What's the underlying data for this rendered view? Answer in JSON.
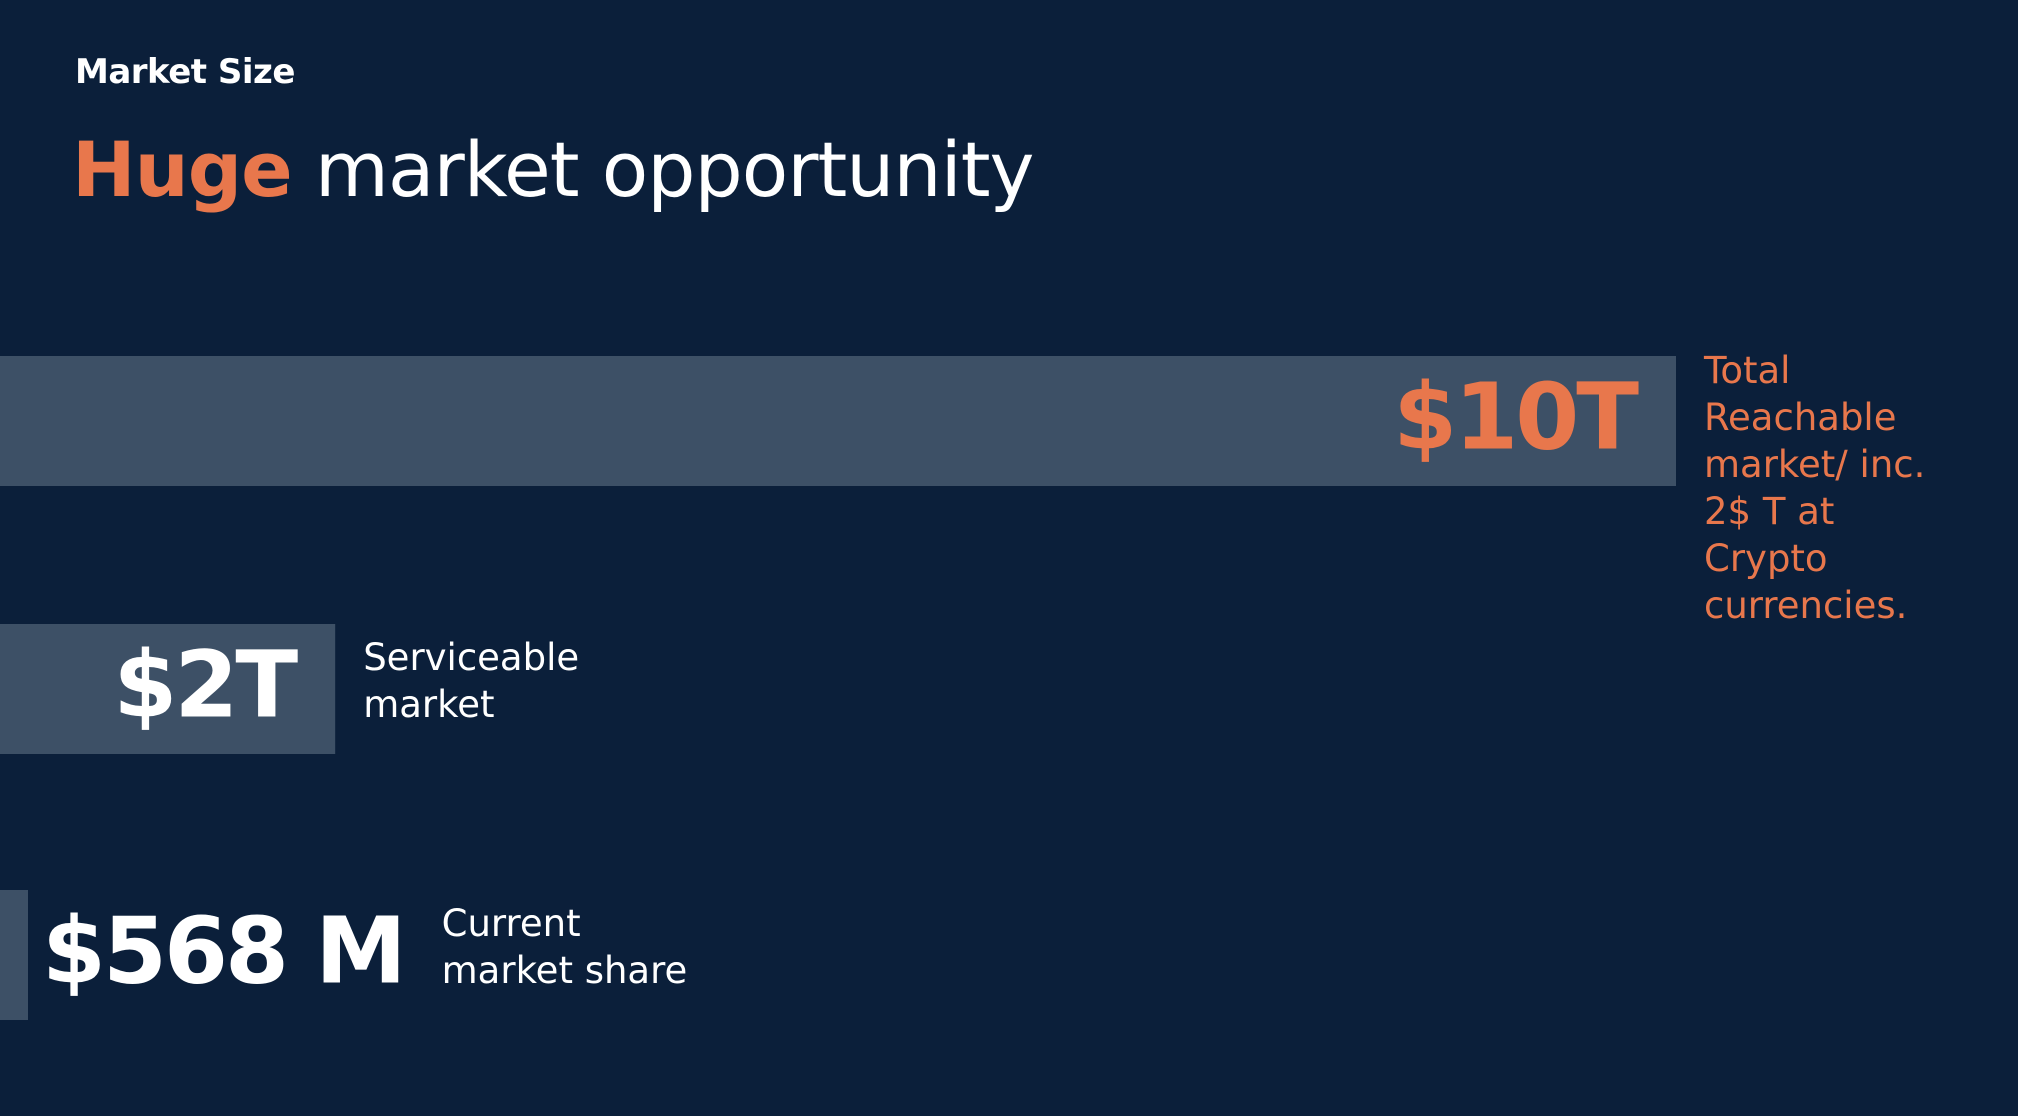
{
  "header": {
    "eyebrow": "Market Size",
    "headline_accent": "Huge",
    "headline_rest": "market opportunity"
  },
  "colors": {
    "background": "#0b1f3a",
    "bar": "#3d5066",
    "accent": "#e8774c",
    "text": "#ffffff"
  },
  "chart_data": {
    "type": "bar",
    "orientation": "horizontal",
    "unit": "USD",
    "title": "",
    "xlabel": "",
    "ylabel": "",
    "grid": false,
    "legend": "none",
    "bars": [
      {
        "value": 10000000000000,
        "label": "$10T",
        "description_lines": [
          "Total",
          "Reachable",
          "market/ inc.",
          "2$ T at",
          "Crypto",
          "currencies."
        ],
        "highlight": true
      },
      {
        "value": 2000000000000,
        "label": "$2T",
        "description_lines": [
          "Serviceable",
          "market"
        ],
        "highlight": false
      },
      {
        "value": 568000000,
        "label": "$568 M",
        "description_lines": [
          "Current",
          "market share"
        ],
        "highlight": false
      }
    ]
  }
}
